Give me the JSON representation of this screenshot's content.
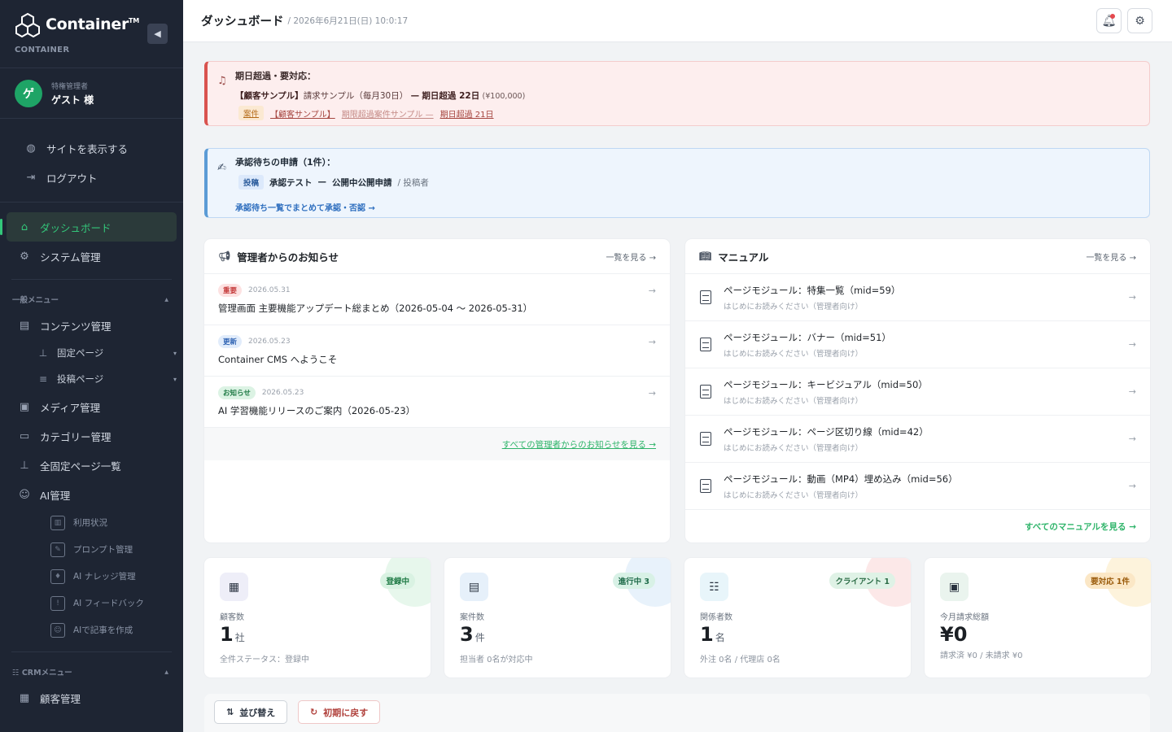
{
  "sidebar": {
    "brand": "Container",
    "brand_tm": "TM",
    "brand_sub": "CONTAINER",
    "collapse_icon": "◀",
    "user": {
      "avatar": "ゲ",
      "role": "特権管理者",
      "name": "ゲスト 様"
    },
    "top_items": [
      {
        "label": "サイトを表示する",
        "icon": "globe-icon"
      },
      {
        "label": "ログアウト",
        "icon": "logout-icon"
      }
    ],
    "main_items": [
      {
        "label": "ダッシュボード",
        "icon": "home-icon",
        "active": true
      },
      {
        "label": "システム管理",
        "icon": "system-settings-icon"
      }
    ],
    "general_menu_label": "一般メニュー",
    "general_items": {
      "content": "コンテンツ管理",
      "fixed_pages": "固定ページ",
      "post_pages": "投稿ページ",
      "media": "メディア管理",
      "category": "カテゴリー管理",
      "all_fixed": "全固定ページ一覧",
      "ai": "AI管理"
    },
    "ai_items": [
      "利用状況",
      "プロンプト管理",
      "AI ナレッジ管理",
      "AI フィードバック",
      "AIで記事を作成"
    ],
    "crm_menu_label": "CRMメニュー",
    "crm_items": [
      "顧客管理"
    ]
  },
  "topbar": {
    "title": "ダッシュボード",
    "date": "/ 2026年6月21日(日) 10:0:17"
  },
  "alert_overdue": {
    "title": "期日超過・要対応：",
    "line1_customer": "【顧客サンプル】",
    "line1_text": "請求サンプル（毎月30日）",
    "line1_sep": "—",
    "line1_status": "期日超過 22日",
    "line1_amount": "(¥100,000)",
    "tag": "案件",
    "line2_customer": "【顧客サンプル】",
    "line2_text": "期限超過案件サンプル —",
    "line2_status": "期日超過 21日"
  },
  "alert_approval": {
    "title": "承認待ちの申請（1件）：",
    "tag": "投稿",
    "item": "承認テスト",
    "sep": "—",
    "status": "公開中公開申請",
    "role": "/ 投稿者",
    "link": "承認待ち一覧でまとめて承認・否認 →"
  },
  "news": {
    "title": "管理者からのお知らせ",
    "more": "一覧を見る →",
    "items": [
      {
        "tag": "重要",
        "date": "2026.05.31",
        "title": "管理画面 主要機能アップデート総まとめ（2026-05-04 〜 2026-05-31）"
      },
      {
        "tag": "更新",
        "date": "2026.05.23",
        "title": "Container CMS へようこそ"
      },
      {
        "tag": "お知らせ",
        "date": "2026.05.23",
        "title": "AI 学習機能リリースのご案内（2026-05-23）"
      }
    ],
    "footer": "すべての管理者からのお知らせを見る →"
  },
  "manual": {
    "title": "マニュアル",
    "more": "一覧を見る →",
    "items": [
      {
        "title": "ページモジュール：特集一覧（mid=59）",
        "sub": "はじめにお読みください（管理者向け）"
      },
      {
        "title": "ページモジュール：バナー（mid=51）",
        "sub": "はじめにお読みください（管理者向け）"
      },
      {
        "title": "ページモジュール：キービジュアル（mid=50）",
        "sub": "はじめにお読みください（管理者向け）"
      },
      {
        "title": "ページモジュール：ページ区切り線（mid=42）",
        "sub": "はじめにお読みください（管理者向け）"
      },
      {
        "title": "ページモジュール：動画（MP4）埋め込み（mid=56）",
        "sub": "はじめにお読みください（管理者向け）"
      }
    ],
    "footer": "すべてのマニュアルを見る →"
  },
  "stats": [
    {
      "label": "顧客数",
      "value": "1",
      "unit": "社",
      "badge": "登録中",
      "foot": "全件ステータス：登録中",
      "icon": "building-icon"
    },
    {
      "label": "案件数",
      "value": "3",
      "unit": "件",
      "badge": "進行中 3",
      "foot": "担当者 0名が対応中",
      "icon": "clipboard-icon"
    },
    {
      "label": "関係者数",
      "value": "1",
      "unit": "名",
      "badge": "クライアント 1",
      "foot": "外注 0名 / 代理店 0名",
      "icon": "people-icon"
    },
    {
      "label": "今月請求総額",
      "value": "¥0",
      "unit": "",
      "badge": "要対応 1件",
      "foot": "請求済 ¥0 / 未請求 ¥0",
      "icon": "money-icon"
    }
  ],
  "toolbar": {
    "sort": "並び替え",
    "reset": "初期に戻す"
  }
}
